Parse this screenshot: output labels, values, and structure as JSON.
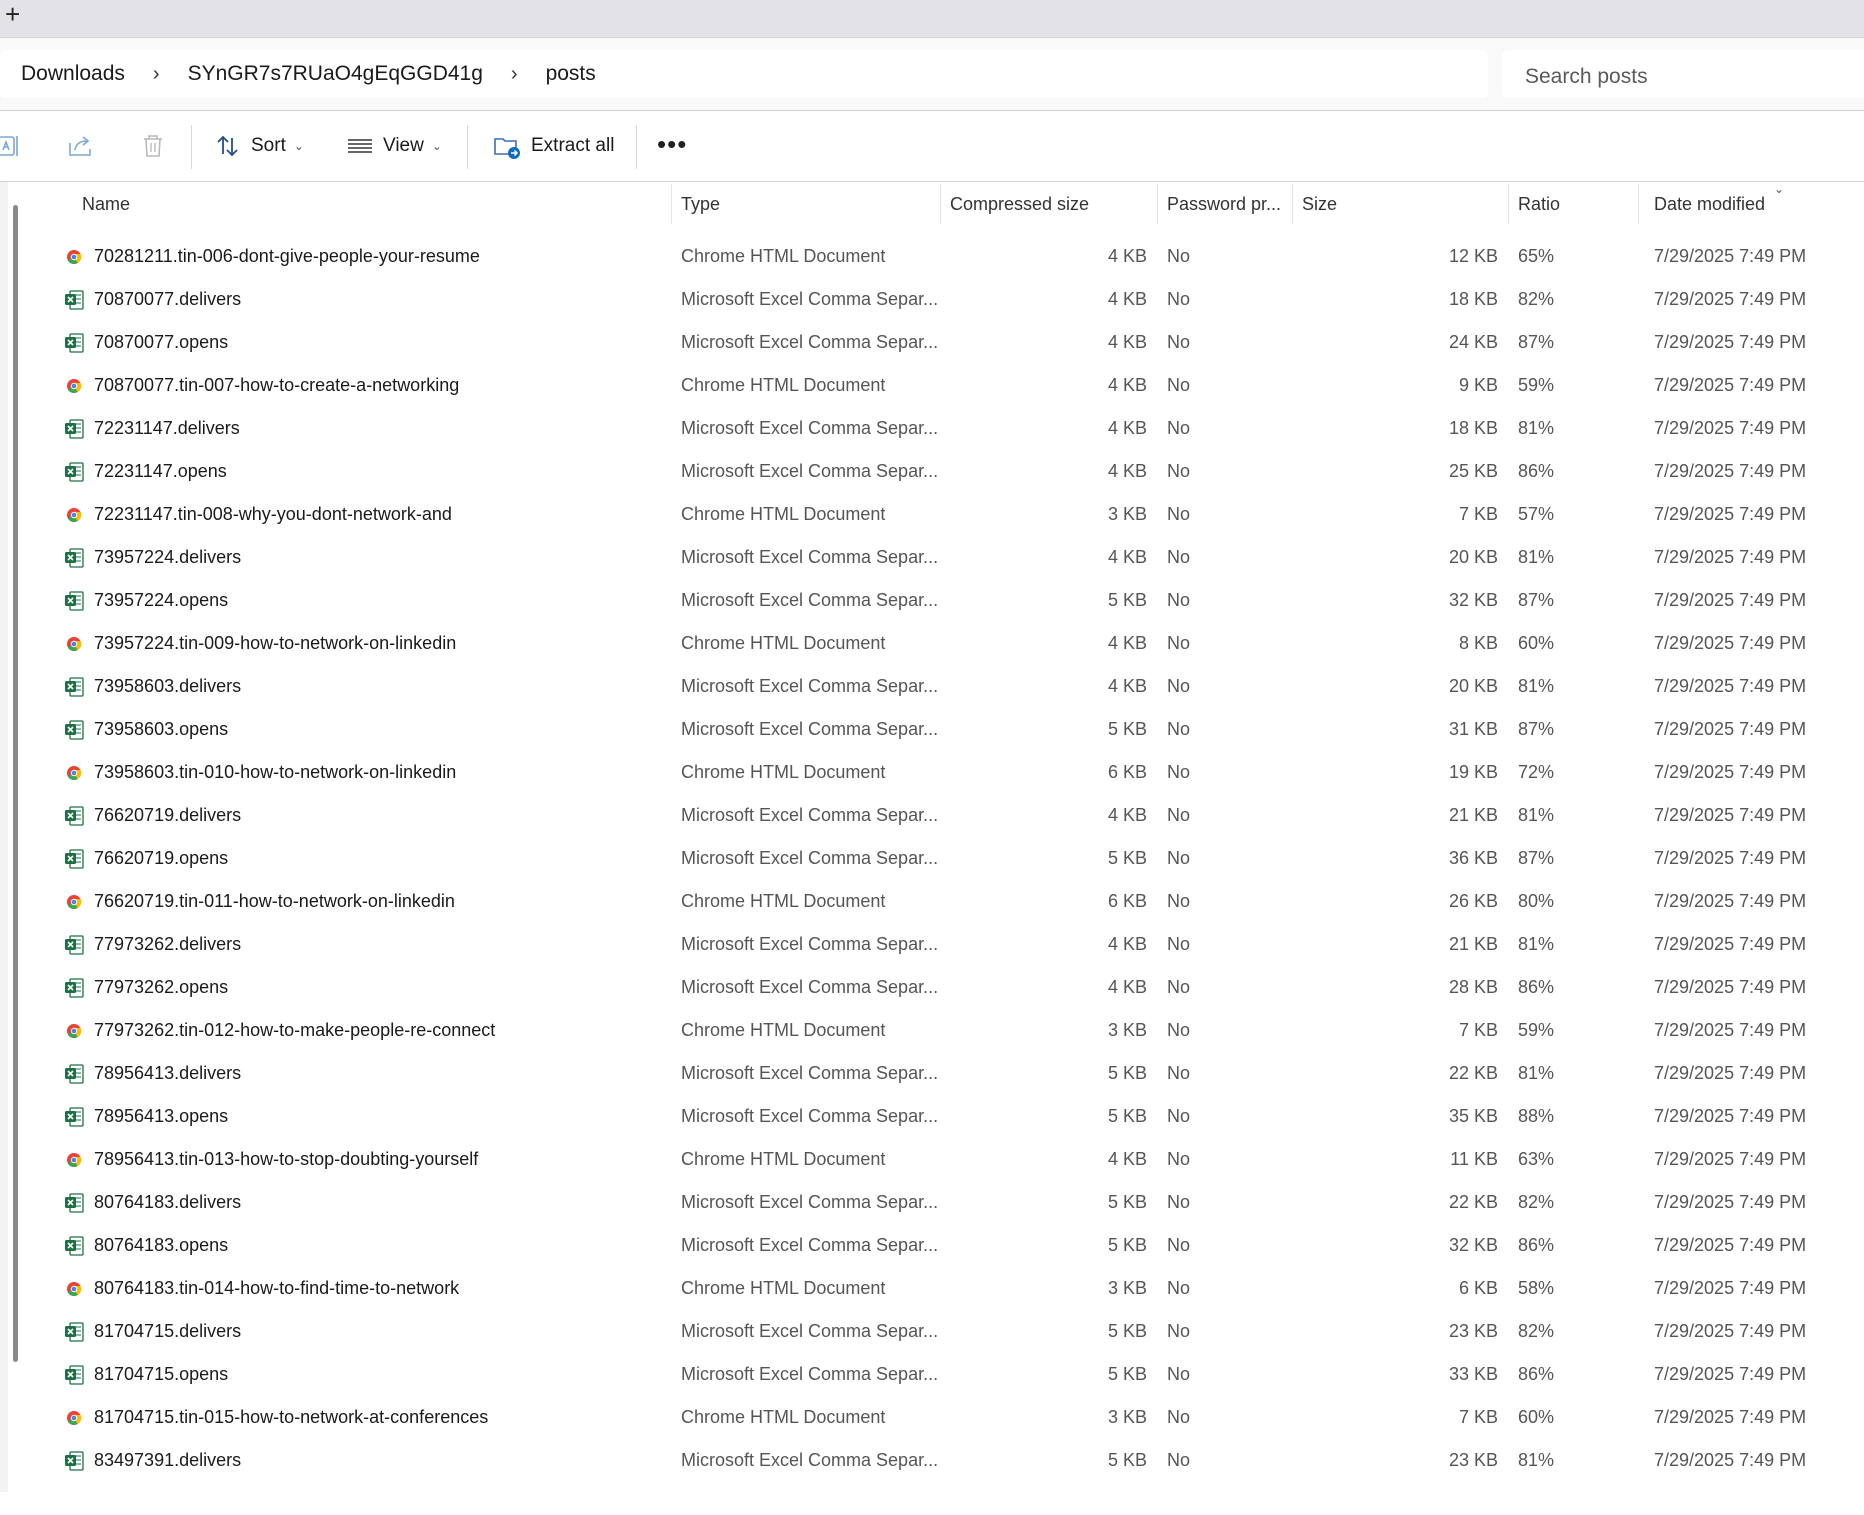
{
  "tabstrip": {
    "new_tab": "+"
  },
  "breadcrumb": {
    "items": [
      "Downloads",
      "SYnGR7s7RUaO4gEqGGD41g",
      "posts"
    ],
    "separator": "›"
  },
  "search": {
    "placeholder": "Search posts"
  },
  "toolbar": {
    "sort_label": "Sort",
    "view_label": "View",
    "extract_label": "Extract all",
    "more_label": "•••"
  },
  "columns": {
    "name": "Name",
    "type": "Type",
    "compressed": "Compressed size",
    "password": "Password pr...",
    "size": "Size",
    "ratio": "Ratio",
    "date": "Date modified"
  },
  "colors": {
    "excel": "#1d7044",
    "accent": "#0f6cbd"
  },
  "rows": [
    {
      "name": "70281211.tin-006-dont-give-people-your-resume",
      "type": "Chrome HTML Document",
      "compressed": "4 KB",
      "password": "No",
      "size": "12 KB",
      "ratio": "65%",
      "date": "7/29/2025 7:49 PM",
      "icon": "chrome-icon"
    },
    {
      "name": "70870077.delivers",
      "type": "Microsoft Excel Comma Separ...",
      "compressed": "4 KB",
      "password": "No",
      "size": "18 KB",
      "ratio": "82%",
      "date": "7/29/2025 7:49 PM",
      "icon": "excel-icon"
    },
    {
      "name": "70870077.opens",
      "type": "Microsoft Excel Comma Separ...",
      "compressed": "4 KB",
      "password": "No",
      "size": "24 KB",
      "ratio": "87%",
      "date": "7/29/2025 7:49 PM",
      "icon": "excel-icon"
    },
    {
      "name": "70870077.tin-007-how-to-create-a-networking",
      "type": "Chrome HTML Document",
      "compressed": "4 KB",
      "password": "No",
      "size": "9 KB",
      "ratio": "59%",
      "date": "7/29/2025 7:49 PM",
      "icon": "chrome-icon"
    },
    {
      "name": "72231147.delivers",
      "type": "Microsoft Excel Comma Separ...",
      "compressed": "4 KB",
      "password": "No",
      "size": "18 KB",
      "ratio": "81%",
      "date": "7/29/2025 7:49 PM",
      "icon": "excel-icon"
    },
    {
      "name": "72231147.opens",
      "type": "Microsoft Excel Comma Separ...",
      "compressed": "4 KB",
      "password": "No",
      "size": "25 KB",
      "ratio": "86%",
      "date": "7/29/2025 7:49 PM",
      "icon": "excel-icon"
    },
    {
      "name": "72231147.tin-008-why-you-dont-network-and",
      "type": "Chrome HTML Document",
      "compressed": "3 KB",
      "password": "No",
      "size": "7 KB",
      "ratio": "57%",
      "date": "7/29/2025 7:49 PM",
      "icon": "chrome-icon"
    },
    {
      "name": "73957224.delivers",
      "type": "Microsoft Excel Comma Separ...",
      "compressed": "4 KB",
      "password": "No",
      "size": "20 KB",
      "ratio": "81%",
      "date": "7/29/2025 7:49 PM",
      "icon": "excel-icon"
    },
    {
      "name": "73957224.opens",
      "type": "Microsoft Excel Comma Separ...",
      "compressed": "5 KB",
      "password": "No",
      "size": "32 KB",
      "ratio": "87%",
      "date": "7/29/2025 7:49 PM",
      "icon": "excel-icon"
    },
    {
      "name": "73957224.tin-009-how-to-network-on-linkedin",
      "type": "Chrome HTML Document",
      "compressed": "4 KB",
      "password": "No",
      "size": "8 KB",
      "ratio": "60%",
      "date": "7/29/2025 7:49 PM",
      "icon": "chrome-icon"
    },
    {
      "name": "73958603.delivers",
      "type": "Microsoft Excel Comma Separ...",
      "compressed": "4 KB",
      "password": "No",
      "size": "20 KB",
      "ratio": "81%",
      "date": "7/29/2025 7:49 PM",
      "icon": "excel-icon"
    },
    {
      "name": "73958603.opens",
      "type": "Microsoft Excel Comma Separ...",
      "compressed": "5 KB",
      "password": "No",
      "size": "31 KB",
      "ratio": "87%",
      "date": "7/29/2025 7:49 PM",
      "icon": "excel-icon"
    },
    {
      "name": "73958603.tin-010-how-to-network-on-linkedin",
      "type": "Chrome HTML Document",
      "compressed": "6 KB",
      "password": "No",
      "size": "19 KB",
      "ratio": "72%",
      "date": "7/29/2025 7:49 PM",
      "icon": "chrome-icon"
    },
    {
      "name": "76620719.delivers",
      "type": "Microsoft Excel Comma Separ...",
      "compressed": "4 KB",
      "password": "No",
      "size": "21 KB",
      "ratio": "81%",
      "date": "7/29/2025 7:49 PM",
      "icon": "excel-icon"
    },
    {
      "name": "76620719.opens",
      "type": "Microsoft Excel Comma Separ...",
      "compressed": "5 KB",
      "password": "No",
      "size": "36 KB",
      "ratio": "87%",
      "date": "7/29/2025 7:49 PM",
      "icon": "excel-icon"
    },
    {
      "name": "76620719.tin-011-how-to-network-on-linkedin",
      "type": "Chrome HTML Document",
      "compressed": "6 KB",
      "password": "No",
      "size": "26 KB",
      "ratio": "80%",
      "date": "7/29/2025 7:49 PM",
      "icon": "chrome-icon"
    },
    {
      "name": "77973262.delivers",
      "type": "Microsoft Excel Comma Separ...",
      "compressed": "4 KB",
      "password": "No",
      "size": "21 KB",
      "ratio": "81%",
      "date": "7/29/2025 7:49 PM",
      "icon": "excel-icon"
    },
    {
      "name": "77973262.opens",
      "type": "Microsoft Excel Comma Separ...",
      "compressed": "4 KB",
      "password": "No",
      "size": "28 KB",
      "ratio": "86%",
      "date": "7/29/2025 7:49 PM",
      "icon": "excel-icon"
    },
    {
      "name": "77973262.tin-012-how-to-make-people-re-connect",
      "type": "Chrome HTML Document",
      "compressed": "3 KB",
      "password": "No",
      "size": "7 KB",
      "ratio": "59%",
      "date": "7/29/2025 7:49 PM",
      "icon": "chrome-icon"
    },
    {
      "name": "78956413.delivers",
      "type": "Microsoft Excel Comma Separ...",
      "compressed": "5 KB",
      "password": "No",
      "size": "22 KB",
      "ratio": "81%",
      "date": "7/29/2025 7:49 PM",
      "icon": "excel-icon"
    },
    {
      "name": "78956413.opens",
      "type": "Microsoft Excel Comma Separ...",
      "compressed": "5 KB",
      "password": "No",
      "size": "35 KB",
      "ratio": "88%",
      "date": "7/29/2025 7:49 PM",
      "icon": "excel-icon"
    },
    {
      "name": "78956413.tin-013-how-to-stop-doubting-yourself",
      "type": "Chrome HTML Document",
      "compressed": "4 KB",
      "password": "No",
      "size": "11 KB",
      "ratio": "63%",
      "date": "7/29/2025 7:49 PM",
      "icon": "chrome-icon"
    },
    {
      "name": "80764183.delivers",
      "type": "Microsoft Excel Comma Separ...",
      "compressed": "5 KB",
      "password": "No",
      "size": "22 KB",
      "ratio": "82%",
      "date": "7/29/2025 7:49 PM",
      "icon": "excel-icon"
    },
    {
      "name": "80764183.opens",
      "type": "Microsoft Excel Comma Separ...",
      "compressed": "5 KB",
      "password": "No",
      "size": "32 KB",
      "ratio": "86%",
      "date": "7/29/2025 7:49 PM",
      "icon": "excel-icon"
    },
    {
      "name": "80764183.tin-014-how-to-find-time-to-network",
      "type": "Chrome HTML Document",
      "compressed": "3 KB",
      "password": "No",
      "size": "6 KB",
      "ratio": "58%",
      "date": "7/29/2025 7:49 PM",
      "icon": "chrome-icon"
    },
    {
      "name": "81704715.delivers",
      "type": "Microsoft Excel Comma Separ...",
      "compressed": "5 KB",
      "password": "No",
      "size": "23 KB",
      "ratio": "82%",
      "date": "7/29/2025 7:49 PM",
      "icon": "excel-icon"
    },
    {
      "name": "81704715.opens",
      "type": "Microsoft Excel Comma Separ...",
      "compressed": "5 KB",
      "password": "No",
      "size": "33 KB",
      "ratio": "86%",
      "date": "7/29/2025 7:49 PM",
      "icon": "excel-icon"
    },
    {
      "name": "81704715.tin-015-how-to-network-at-conferences",
      "type": "Chrome HTML Document",
      "compressed": "3 KB",
      "password": "No",
      "size": "7 KB",
      "ratio": "60%",
      "date": "7/29/2025 7:49 PM",
      "icon": "chrome-icon"
    },
    {
      "name": "83497391.delivers",
      "type": "Microsoft Excel Comma Separ...",
      "compressed": "5 KB",
      "password": "No",
      "size": "23 KB",
      "ratio": "81%",
      "date": "7/29/2025 7:49 PM",
      "icon": "excel-icon"
    }
  ]
}
